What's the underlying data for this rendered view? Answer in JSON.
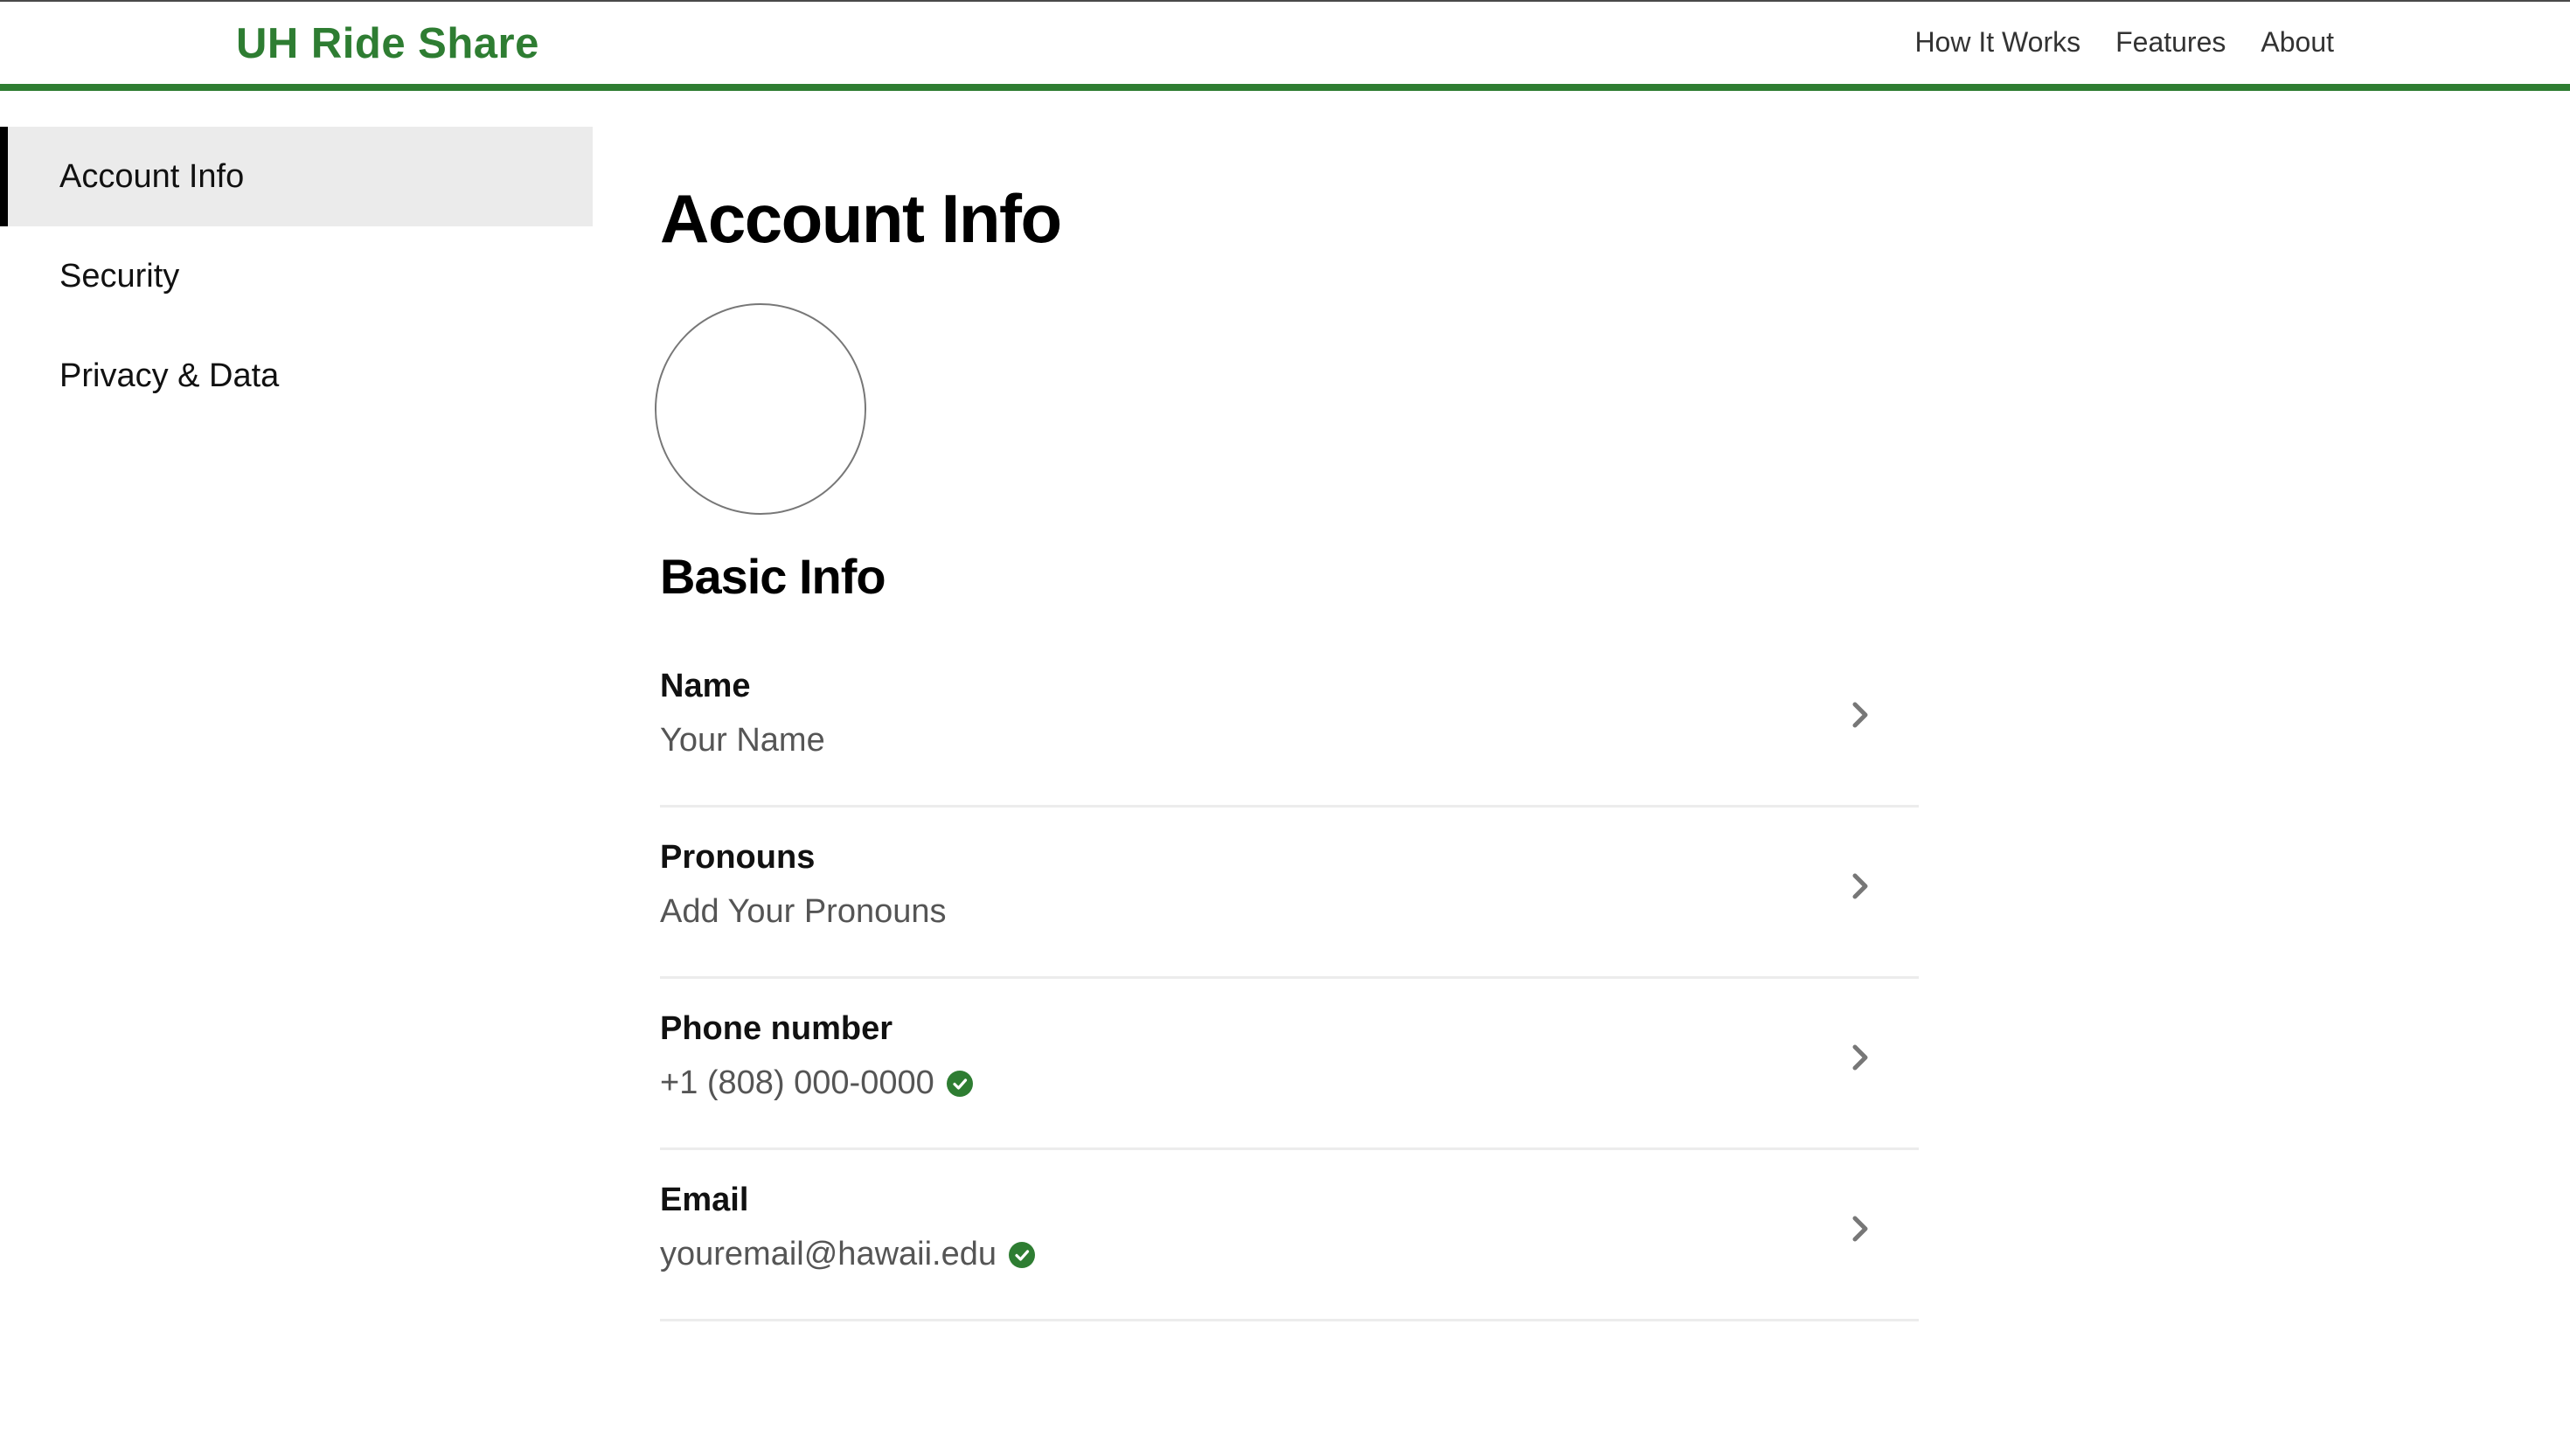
{
  "header": {
    "brand": "UH Ride Share",
    "nav": [
      "How It Works",
      "Features",
      "About"
    ]
  },
  "sidebar": {
    "items": [
      {
        "label": "Account Info",
        "active": true
      },
      {
        "label": "Security",
        "active": false
      },
      {
        "label": "Privacy & Data",
        "active": false
      }
    ]
  },
  "main": {
    "title": "Account Info",
    "section_title": "Basic Info",
    "rows": [
      {
        "label": "Name",
        "value": "Your Name",
        "verified": false
      },
      {
        "label": "Pronouns",
        "value": "Add Your Pronouns",
        "verified": false
      },
      {
        "label": "Phone number",
        "value": "+1 (808) 000-0000",
        "verified": true
      },
      {
        "label": "Email",
        "value": "youremail@hawaii.edu",
        "verified": true
      }
    ]
  },
  "colors": {
    "brand": "#2e7d32",
    "verified": "#2e7d32",
    "active_bg": "#ebebeb"
  },
  "icons": {
    "row_chevron": "chevron-right-icon",
    "verified": "check-circle-icon"
  }
}
